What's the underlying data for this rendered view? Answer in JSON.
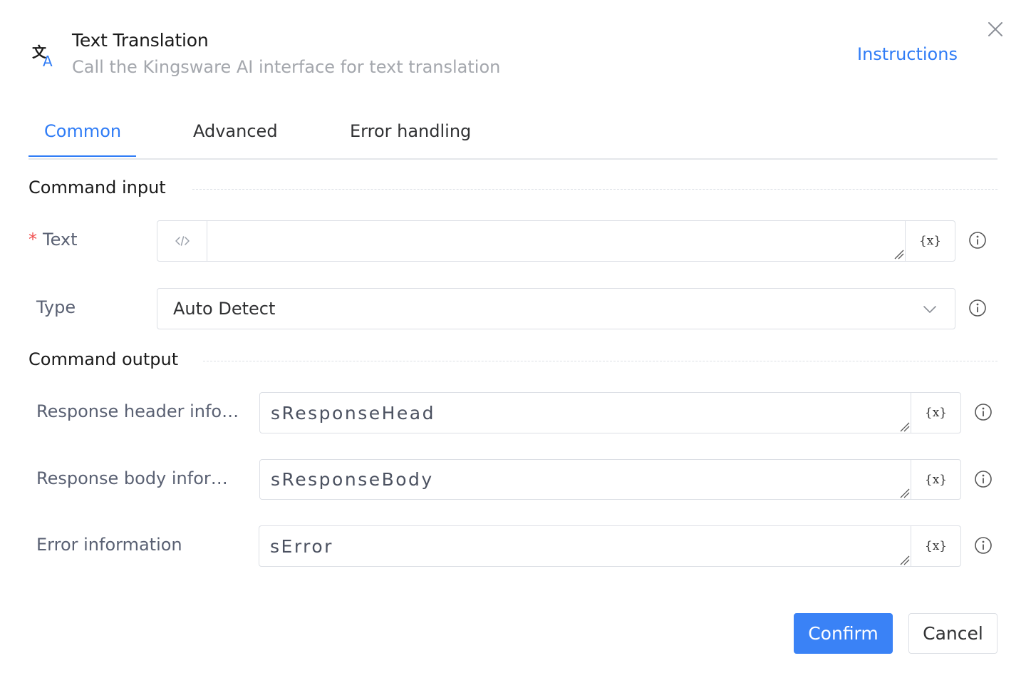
{
  "header": {
    "title": "Text Translation",
    "subtitle": "Call the Kingsware AI interface for text translation",
    "instructions_link": "Instructions"
  },
  "tabs": [
    {
      "label": "Common",
      "active": true
    },
    {
      "label": "Advanced",
      "active": false
    },
    {
      "label": "Error handling",
      "active": false
    }
  ],
  "input_section": {
    "title": "Command input",
    "text_field": {
      "label": "Text",
      "required_mark": "*",
      "value": "",
      "var_button": "{x}"
    },
    "type_field": {
      "label": "Type",
      "selected": "Auto Detect"
    }
  },
  "output_section": {
    "title": "Command output",
    "fields": [
      {
        "label": "Response header info…",
        "value": "sResponseHead",
        "var_button": "{x}"
      },
      {
        "label": "Response body infor…",
        "value": "sResponseBody",
        "var_button": "{x}"
      },
      {
        "label": "Error information",
        "value": "sError",
        "var_button": "{x}"
      }
    ]
  },
  "footer": {
    "confirm_label": "Confirm",
    "cancel_label": "Cancel"
  },
  "colors": {
    "accent": "#2f7cf6",
    "required": "#f04e4e",
    "primary_button": "#3a82f6"
  },
  "icons": {
    "header": "translate-icon",
    "close": "close-icon",
    "code": "code-icon",
    "info": "info-icon",
    "dropdown": "chevron-down-icon"
  }
}
